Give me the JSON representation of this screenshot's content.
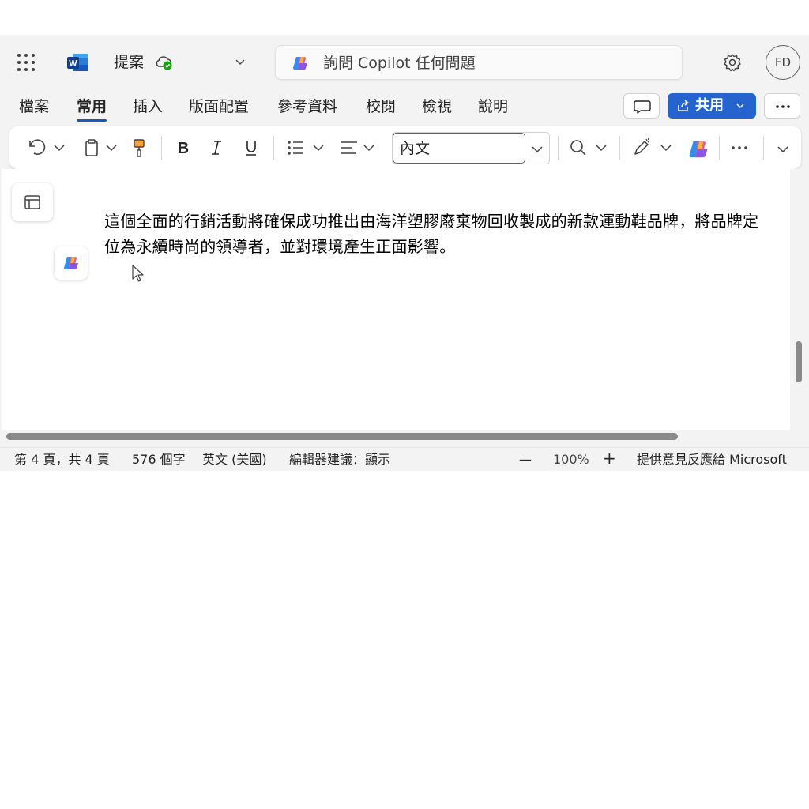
{
  "titlebar": {
    "doc_title": "提案",
    "copilot_placeholder": "詢問 Copilot 任何問題",
    "avatar_initials": "FD"
  },
  "tabs": [
    {
      "label": "檔案"
    },
    {
      "label": "常用"
    },
    {
      "label": "插入"
    },
    {
      "label": "版面配置"
    },
    {
      "label": "參考資料"
    },
    {
      "label": "校閱"
    },
    {
      "label": "檢視"
    },
    {
      "label": "說明"
    }
  ],
  "ribbon": {
    "share_label": "共用",
    "style_value": "內文"
  },
  "document": {
    "paragraph": "這個全面的行銷活動將確保成功推出由海洋塑膠廢棄物回收製成的新款運動鞋品牌，將品牌定位為永續時尚的領導者，並對環境產生正面影響。"
  },
  "status": {
    "page": "第 4 頁，共 4 頁",
    "words": "576 個字",
    "language": "英文 (美國)",
    "editor": "編輯器建議：顯示",
    "zoom_out": "—",
    "zoom": "100%",
    "zoom_in": "+",
    "feedback": "提供意見反應給 Microsoft"
  },
  "colors": {
    "accent": "#2564cf",
    "active_tab_underline": "#185abd",
    "cloud_ok": "#13a10e"
  }
}
